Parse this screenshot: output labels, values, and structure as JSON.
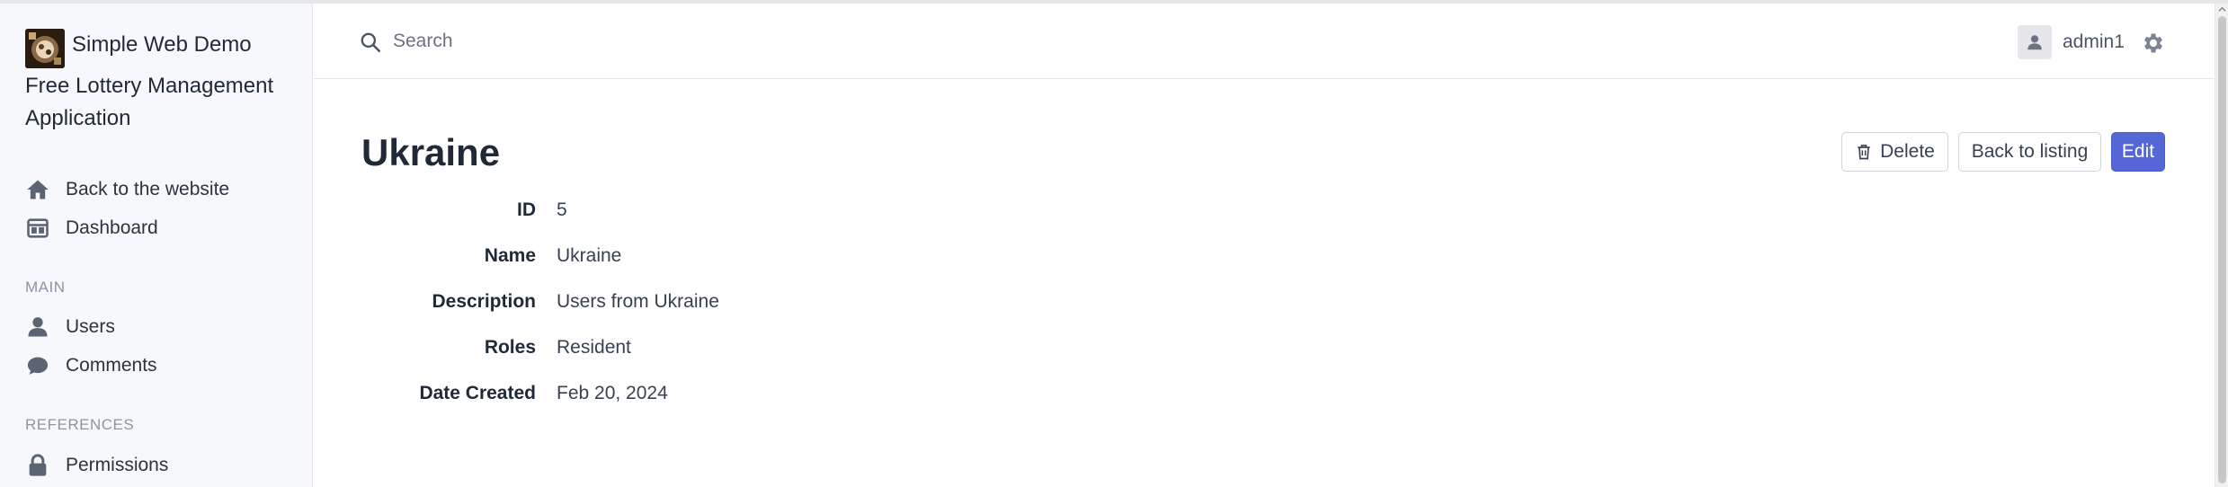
{
  "app": {
    "brand_line1": "Simple Web Demo",
    "brand_line2": "Free Lottery Management Application"
  },
  "sidebar": {
    "top_items": [
      {
        "label": "Back to the website",
        "icon": "home-icon"
      },
      {
        "label": "Dashboard",
        "icon": "dashboard-icon"
      }
    ],
    "sections": [
      {
        "title": "MAIN",
        "items": [
          {
            "label": "Users",
            "icon": "user-icon"
          },
          {
            "label": "Comments",
            "icon": "comment-icon"
          }
        ]
      },
      {
        "title": "REFERENCES",
        "items": [
          {
            "label": "Permissions",
            "icon": "lock-icon"
          }
        ]
      }
    ]
  },
  "header": {
    "search_placeholder": "Search",
    "username": "admin1"
  },
  "page": {
    "title": "Ukraine",
    "actions": {
      "delete": "Delete",
      "back": "Back to listing",
      "edit": "Edit"
    },
    "fields": [
      {
        "label": "ID",
        "value": "5"
      },
      {
        "label": "Name",
        "value": "Ukraine"
      },
      {
        "label": "Description",
        "value": "Users from Ukraine"
      },
      {
        "label": "Roles",
        "value": "Resident"
      },
      {
        "label": "Date Created",
        "value": "Feb 20, 2024"
      }
    ]
  },
  "colors": {
    "primary": "#5566d6",
    "sidebar_bg": "#f6f8fb",
    "icon": "#5b6472"
  }
}
